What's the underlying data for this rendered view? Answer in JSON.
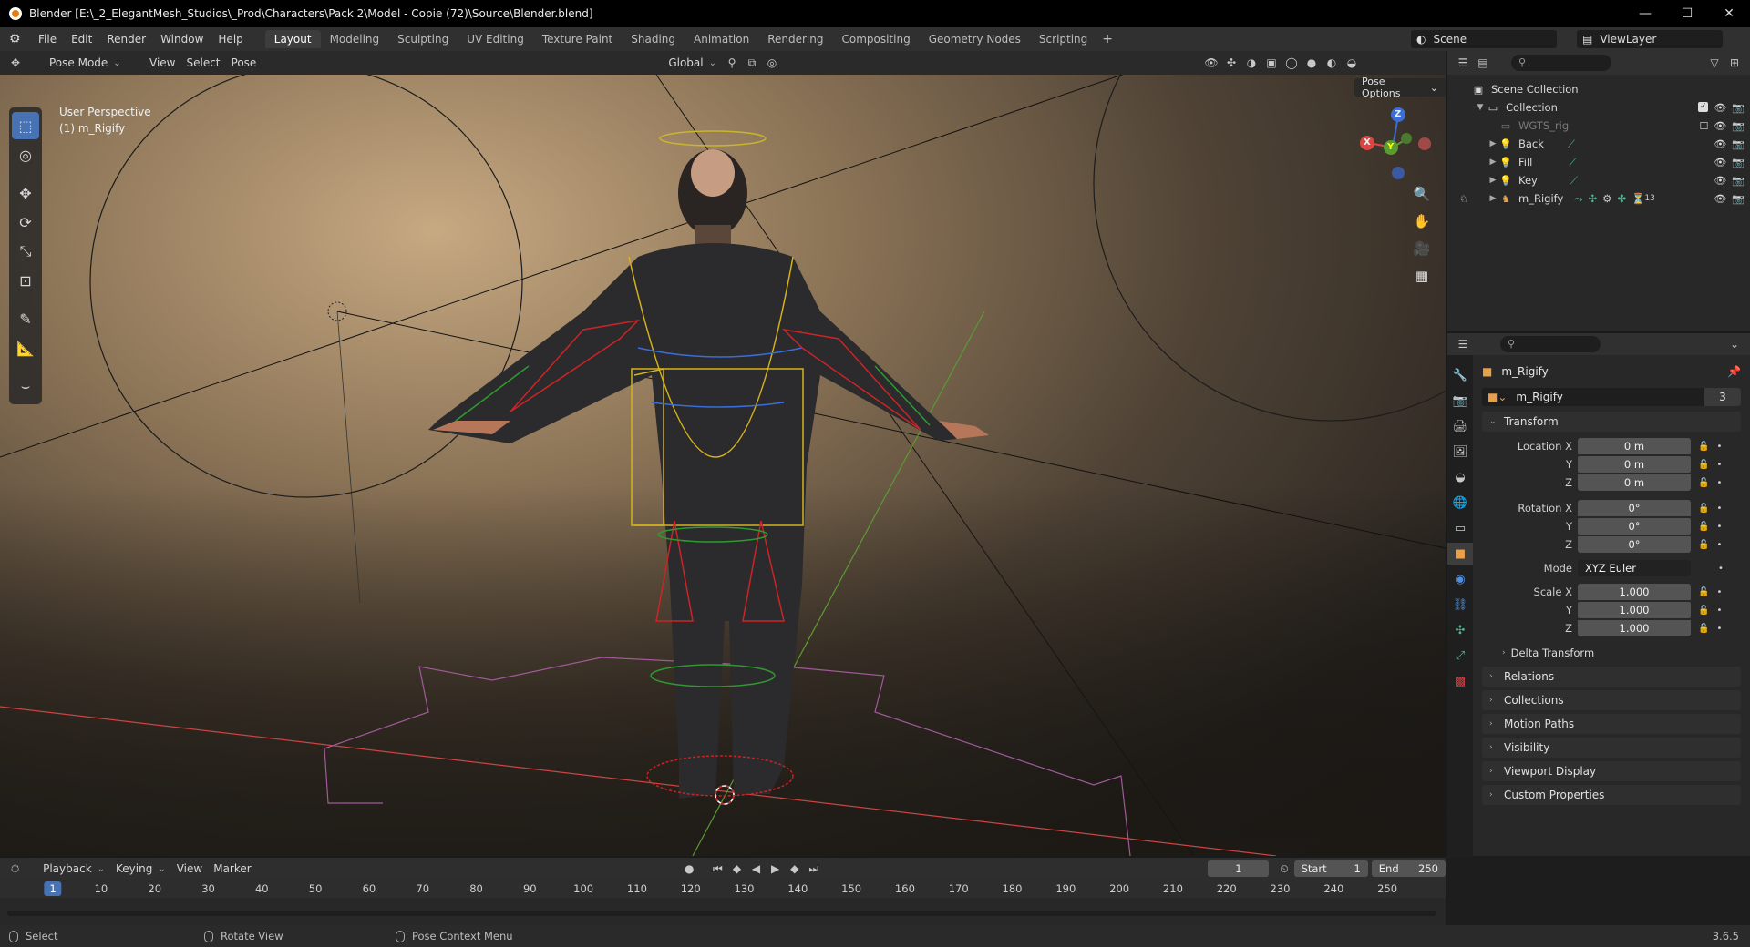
{
  "titlebar": {
    "title": "Blender [E:\\_2_ElegantMesh_Studios\\_Prod\\Characters\\Pack 2\\Model - Copie (72)\\Source\\Blender.blend]",
    "minimize": "—",
    "maximize": "☐",
    "close": "✕"
  },
  "menubar": {
    "menus": [
      "File",
      "Edit",
      "Render",
      "Window",
      "Help"
    ],
    "workspaces": [
      "Layout",
      "Modeling",
      "Sculpting",
      "UV Editing",
      "Texture Paint",
      "Shading",
      "Animation",
      "Rendering",
      "Compositing",
      "Geometry Nodes",
      "Scripting"
    ],
    "active_workspace": "Layout",
    "add_workspace": "+",
    "scene": "Scene",
    "view_layer": "ViewLayer"
  },
  "viewport_header": {
    "mode": "Pose Mode",
    "menus": [
      "View",
      "Select",
      "Pose"
    ],
    "orientation": "Global",
    "pose_options": "Pose Options"
  },
  "viewport": {
    "perspective_label": "User Perspective",
    "object_label": "(1) m_Rigify",
    "gizmo": {
      "x": "X",
      "y": "Y",
      "z": "Z"
    }
  },
  "outliner": {
    "scene_collection": "Scene Collection",
    "collection": "Collection",
    "items": [
      {
        "name": "WGTS_rig",
        "dim": true
      },
      {
        "name": "Back",
        "dim": false
      },
      {
        "name": "Fill",
        "dim": false
      },
      {
        "name": "Key",
        "dim": false
      },
      {
        "name": "m_Rigify",
        "dim": false,
        "badge": "13"
      }
    ]
  },
  "properties": {
    "object_name": "m_Rigify",
    "datablock_name": "m_Rigify",
    "datablock_users": "3",
    "transform": {
      "title": "Transform",
      "location_label": "Location X",
      "location": [
        "0 m",
        "0 m",
        "0 m"
      ],
      "rotation_label": "Rotation X",
      "rotation": [
        "0°",
        "0°",
        "0°"
      ],
      "mode_label": "Mode",
      "mode": "XYZ Euler",
      "scale_label": "Scale X",
      "scale": [
        "1.000",
        "1.000",
        "1.000"
      ],
      "axis_y": "Y",
      "axis_z": "Z",
      "delta": "Delta Transform"
    },
    "panels": [
      "Relations",
      "Collections",
      "Motion Paths",
      "Visibility",
      "Viewport Display",
      "Custom Properties"
    ]
  },
  "timeline": {
    "menus": [
      "Playback",
      "Keying",
      "View",
      "Marker"
    ],
    "current_frame": "1",
    "start_label": "Start",
    "start": "1",
    "end_label": "End",
    "end": "250",
    "ticks": [
      "10",
      "20",
      "30",
      "40",
      "50",
      "60",
      "70",
      "80",
      "90",
      "100",
      "110",
      "120",
      "130",
      "140",
      "150",
      "160",
      "170",
      "180",
      "190",
      "200",
      "210",
      "220",
      "230",
      "240",
      "250"
    ],
    "playhead": "1"
  },
  "statusbar": {
    "select": "Select",
    "rotate": "Rotate View",
    "context": "Pose Context Menu",
    "version": "3.6.5"
  }
}
